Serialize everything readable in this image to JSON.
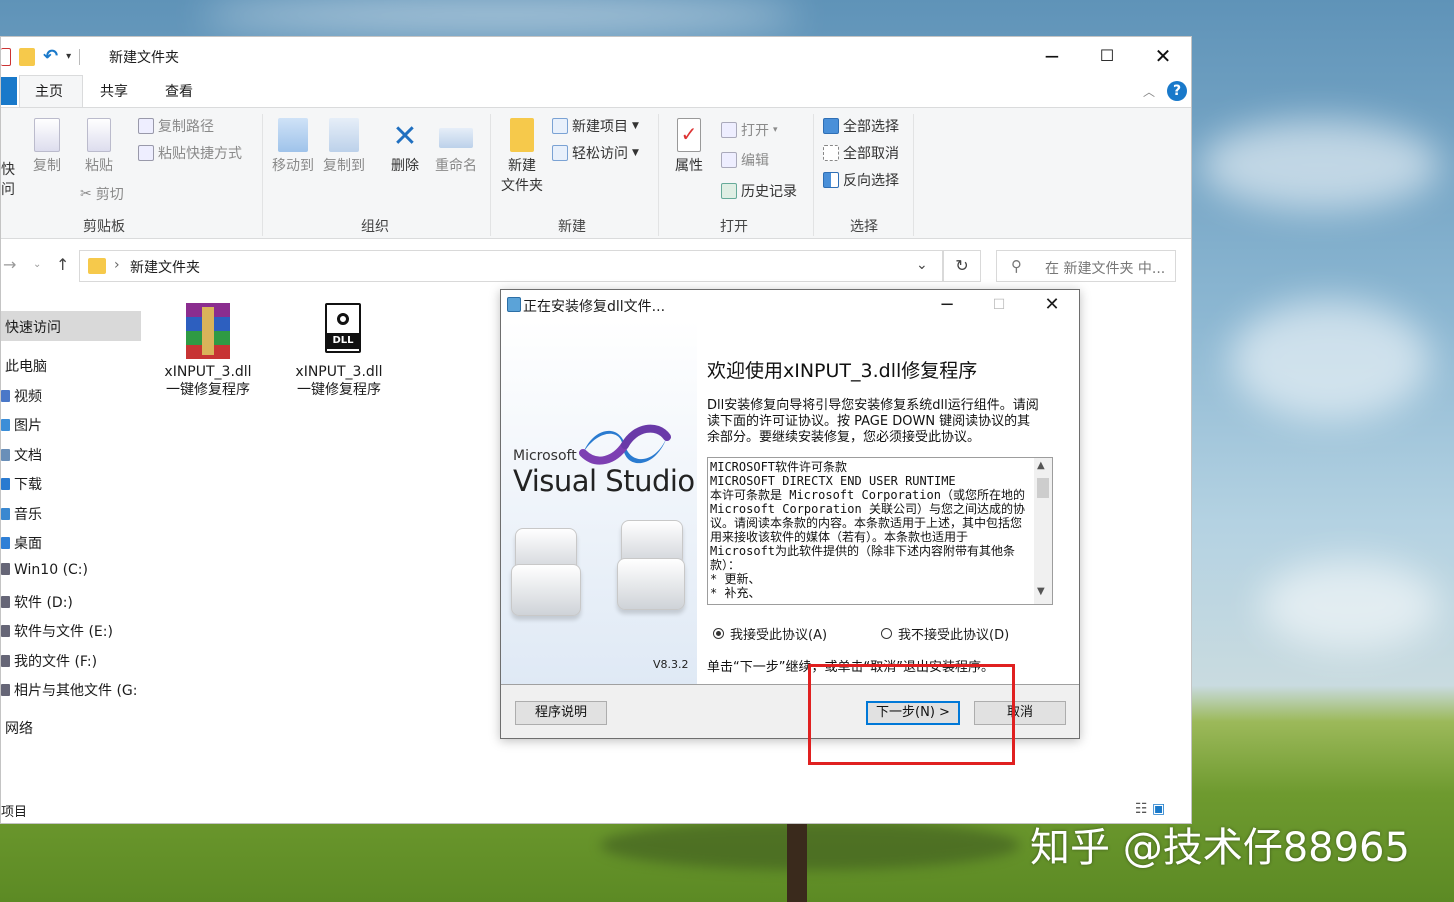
{
  "explorer": {
    "title": "新建文件夹",
    "tabs": [
      {
        "label": "主页"
      },
      {
        "label": "共享"
      },
      {
        "label": "查看"
      }
    ],
    "ribbon": {
      "clipboard": {
        "pin_label": "快",
        "pin_label2": "问",
        "copy": "复制",
        "paste": "粘贴",
        "copy_path": "复制路径",
        "paste_shortcut": "粘贴快捷方式",
        "cut": "剪切",
        "group": "剪贴板"
      },
      "organize": {
        "move_to": "移动到",
        "copy_to": "复制到",
        "delete": "删除",
        "rename": "重命名",
        "group": "组织"
      },
      "new": {
        "new_folder_1": "新建",
        "new_folder_2": "文件夹",
        "new_item": "新建项目",
        "easy_access": "轻松访问",
        "group": "新建"
      },
      "open": {
        "properties": "属性",
        "open": "打开",
        "edit": "编辑",
        "history": "历史记录",
        "group": "打开"
      },
      "select": {
        "select_all": "全部选择",
        "select_none": "全部取消",
        "invert": "反向选择",
        "group": "选择"
      }
    },
    "address": {
      "path": "新建文件夹",
      "search_placeholder": "在 新建文件夹 中..."
    },
    "nav": {
      "quick_access": "快速访问",
      "this_pc": "此电脑",
      "items": [
        {
          "label": "视频",
          "color": "#4a78c8"
        },
        {
          "label": "图片",
          "color": "#3b8ed8"
        },
        {
          "label": "文档",
          "color": "#6a8fb8"
        },
        {
          "label": "下载",
          "color": "#2a7ad0"
        },
        {
          "label": "音乐",
          "color": "#3a88d0"
        },
        {
          "label": "桌面",
          "color": "#2f7fd6"
        },
        {
          "label": "Win10 (C:)",
          "color": "#667"
        },
        {
          "label": "软件 (D:)",
          "color": "#667"
        },
        {
          "label": "软件与文件 (E:)",
          "color": "#667"
        },
        {
          "label": "我的文件 (F:)",
          "color": "#667"
        },
        {
          "label": "相片与其他文件 (G:",
          "color": "#667"
        }
      ],
      "network": "网络"
    },
    "files": [
      {
        "name_line1": "xINPUT_3.dll",
        "name_line2": "一键修复程序",
        "icon": "winrar-archive-icon"
      },
      {
        "name_line1": "xINPUT_3.dll",
        "name_line2": "一键修复程序",
        "icon": "dll-file-icon"
      }
    ],
    "status": "项目"
  },
  "installer": {
    "title": "正在安装修复dll文件...",
    "brand_small": "Microsoft",
    "brand_large": "Visual Studio",
    "version": "V8.3.2",
    "heading": "欢迎使用xINPUT_3.dll修复程序",
    "description": "Dll安装修复向导将引导您安装修复系统dll运行组件。请阅读下面的许可证协议。按 PAGE DOWN 键阅读协议的其余部分。要继续安装修复，您必须接受此协议。",
    "license_text": "MICROSOFT软件许可条款\nMICROSOFT DIRECTX END USER RUNTIME\n本许可条款是 Microsoft Corporation（或您所在地的 Microsoft Corporation 关联公司）与您之间达成的协议。请阅读本条款的内容。本条款适用于上述，其中包括您用来接收该软件的媒体（若有）。本条款也适用于Microsoft为此软件提供的（除非下述内容附带有其他条款）：\n* 更新、\n* 补充、",
    "accept": "我接受此协议(A)",
    "decline": "我不接受此协议(D)",
    "hint": "单击“下一步”继续，或单击“取消”退出安装程序。",
    "help_button": "程序说明",
    "next_button": "下一步(N) >",
    "cancel_button": "取消"
  },
  "watermark": "知乎 @技术仔88965"
}
